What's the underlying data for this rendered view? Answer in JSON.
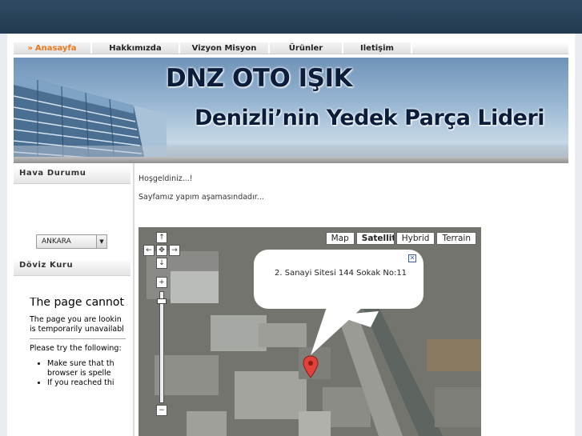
{
  "nav": {
    "items": [
      {
        "label": "Anasayfa",
        "active": true
      },
      {
        "label": "Hakkımızda",
        "active": false
      },
      {
        "label": "Vizyon Misyon",
        "active": false
      },
      {
        "label": "Ürünler",
        "active": false
      },
      {
        "label": "Iletişim",
        "active": false
      }
    ],
    "active_color": "#e8761a"
  },
  "banner": {
    "title": "DNZ OTO IŞIK",
    "subtitle": "Denizli’nin Yedek Parça Lideri"
  },
  "sidebar": {
    "weather_title": "Hava Durumu",
    "city_select": "ANKARA",
    "currency_title": "Döviz Kuru",
    "error": {
      "heading": "The page cannot",
      "line1": "The page you are lookin",
      "line2": "is temporarily unavailabl",
      "try": "Please try the following:",
      "bullet1a": "Make sure that th",
      "bullet1b": "browser is spelle",
      "bullet2": "If you reached thi"
    }
  },
  "main": {
    "welcome": "Hoşgeldiniz...!",
    "construction": "Sayfamız yapım aşamasındadır..."
  },
  "map": {
    "types": [
      "Map",
      "Satellite",
      "Hybrid",
      "Terrain"
    ],
    "selected_type": "Satellite",
    "info_text": "2. Sanayi Sitesi 144 Sokak No:11"
  },
  "colors": {
    "topbar": "#2a4359",
    "accent": "#e8761a",
    "banner_text": "#0b1d3a"
  }
}
